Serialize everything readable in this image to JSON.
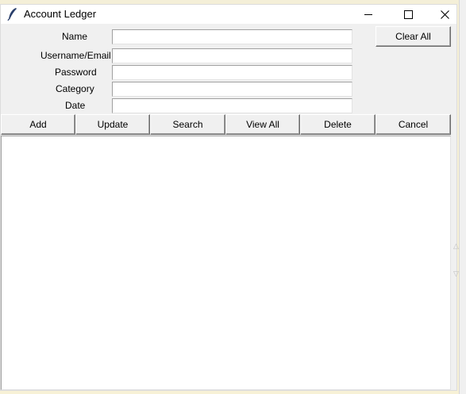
{
  "window": {
    "title": "Account Ledger",
    "icon": "feather-icon"
  },
  "form": {
    "fields": [
      {
        "label": "Name",
        "value": ""
      },
      {
        "label": "Username/Email",
        "value": ""
      },
      {
        "label": "Password",
        "value": ""
      },
      {
        "label": "Category",
        "value": ""
      },
      {
        "label": "Date",
        "value": ""
      }
    ],
    "clear_all_label": "Clear All"
  },
  "toolbar": {
    "add": "Add",
    "update": "Update",
    "search": "Search",
    "view_all": "View All",
    "delete": "Delete",
    "cancel": "Cancel"
  },
  "results": {
    "items": []
  },
  "colors": {
    "window_bg": "#f0f0f0",
    "titlebar_bg": "#ffffff",
    "desktop_bg": "#f7f1d6"
  }
}
